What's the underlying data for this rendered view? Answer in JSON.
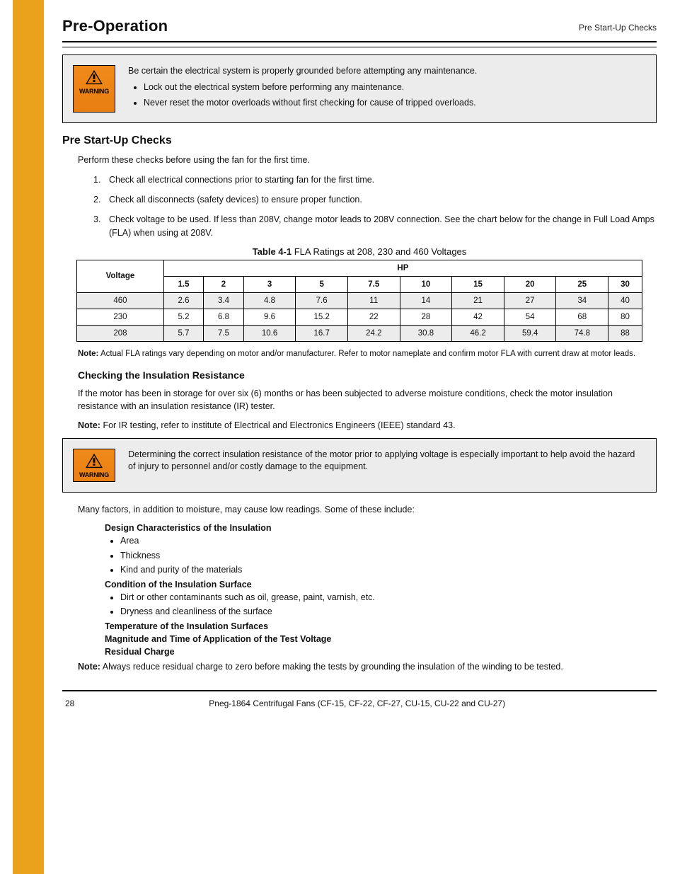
{
  "header": {
    "left": "Pre-Operation",
    "right": "Pre Start-Up Checks"
  },
  "warning1": {
    "label": "WARNING",
    "lead": "Be certain the electrical system is properly grounded before attempting any maintenance.",
    "items": [
      "Lock out the electrical system before performing any maintenance.",
      "Never reset the motor overloads without first checking for cause of tripped overloads."
    ]
  },
  "section_title": "Pre Start-Up Checks",
  "prestart_para": "Perform these checks before using the fan for the first time.",
  "notes": [
    "Check all electrical connections prior to starting fan for the first time.",
    "Check all disconnects (safety devices) to ensure proper function.",
    "Check voltage to be used. If less than 208V, change motor leads to 208V connection. See the chart below for the change in Full Load Amps (FLA) when using at 208V."
  ],
  "table": {
    "caption_label": "Table 4-1",
    "caption_text": "FLA Ratings at 208, 230 and 460 Voltages",
    "row_header": "Voltage",
    "hp_label": "HP",
    "hps": [
      "1.5",
      "2",
      "3",
      "5",
      "7.5",
      "10",
      "15",
      "20",
      "25",
      "30"
    ],
    "rows": [
      {
        "voltage": "460",
        "vals": [
          "2.6",
          "3.4",
          "4.8",
          "7.6",
          "11",
          "14",
          "21",
          "27",
          "34",
          "40"
        ]
      },
      {
        "voltage": "230",
        "vals": [
          "5.2",
          "6.8",
          "9.6",
          "15.2",
          "22",
          "28",
          "42",
          "54",
          "68",
          "80"
        ]
      },
      {
        "voltage": "208",
        "vals": [
          "5.7",
          "7.5",
          "10.6",
          "16.7",
          "24.2",
          "30.8",
          "46.2",
          "59.4",
          "74.8",
          "88"
        ]
      }
    ],
    "note_label": "Note:",
    "note_text": "Actual FLA ratings vary depending on motor and/or manufacturer. Refer to motor nameplate and confirm motor FLA with current draw at motor leads."
  },
  "checking": {
    "heading": "Checking the Insulation Resistance",
    "para": "If the motor has been in storage for over six (6) months or has been subjected to adverse moisture conditions, check the motor insulation resistance with an insulation resistance (IR) tester.",
    "note_label": "Note:",
    "note_text": "For IR testing, refer to institute of Electrical and Electronics Engineers (IEEE) standard 43."
  },
  "warning2": {
    "label": "WARNING",
    "text": "Determining the correct insulation resistance of the motor prior to applying voltage is especially important to help avoid the hazard of injury to personnel and/or costly damage to the equipment."
  },
  "factors": {
    "intro": "Many factors, in addition to moisture, may cause low readings. Some of these include:",
    "col1_head": "Design Characteristics of the Insulation",
    "col1_items": [
      "Area",
      "Thickness",
      "Kind and purity of the materials"
    ],
    "col2_head": "Condition of the Insulation Surface",
    "col2_items": [
      "Dirt or other contaminants such as oil, grease, paint, varnish, etc.",
      "Dryness and cleanliness of the surface"
    ],
    "col3_head": "Temperature of the Insulation Surfaces",
    "col4_head": "Magnitude and Time of Application of the Test Voltage",
    "col5_head": "Residual Charge",
    "note_label": "Note:",
    "note_text": "Always reduce residual charge to zero before making the tests by grounding the insulation of the winding to be tested."
  },
  "footer": {
    "left": "28",
    "center": "Pneg-1864 Centrifugal Fans (CF-15, CF-22, CF-27, CU-15, CU-22 and CU-27)"
  }
}
